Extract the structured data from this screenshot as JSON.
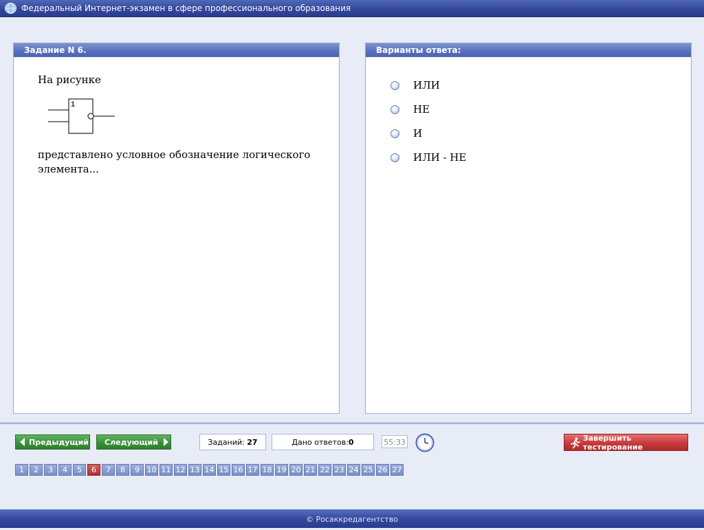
{
  "window": {
    "title": "Федеральный Интернет-экзамен в сфере профессионального образования"
  },
  "task": {
    "header": "Задание N 6.",
    "text_before": "На рисунке",
    "text_after_line1": "представлено условное обозначение логического",
    "text_after_line2": "элемента...",
    "figure_label": "1"
  },
  "answers": {
    "header": "Варианты ответа:",
    "options": [
      "ИЛИ",
      "НЕ",
      "И",
      "ИЛИ - НЕ"
    ]
  },
  "controls": {
    "prev_label": "Предыдущий",
    "next_label": "Следующий",
    "tasks_label": "Заданий:",
    "tasks_count": "27",
    "answered_label": "Дано ответов:",
    "answered_count": "0",
    "timer": "55:33",
    "finish_label": "Завершить тестирование"
  },
  "pager": {
    "pages": [
      "1",
      "2",
      "3",
      "4",
      "5",
      "6",
      "7",
      "8",
      "9",
      "10",
      "11",
      "12",
      "13",
      "14",
      "15",
      "16",
      "17",
      "18",
      "19",
      "20",
      "21",
      "22",
      "23",
      "24",
      "25",
      "26",
      "27"
    ],
    "current": "6"
  },
  "footer": {
    "text": "© Росаккредагентство"
  },
  "colors": {
    "accent": "#34479c",
    "active_page": "#b03030",
    "nav_button": "#3a913a",
    "finish_button": "#c63a3a"
  }
}
